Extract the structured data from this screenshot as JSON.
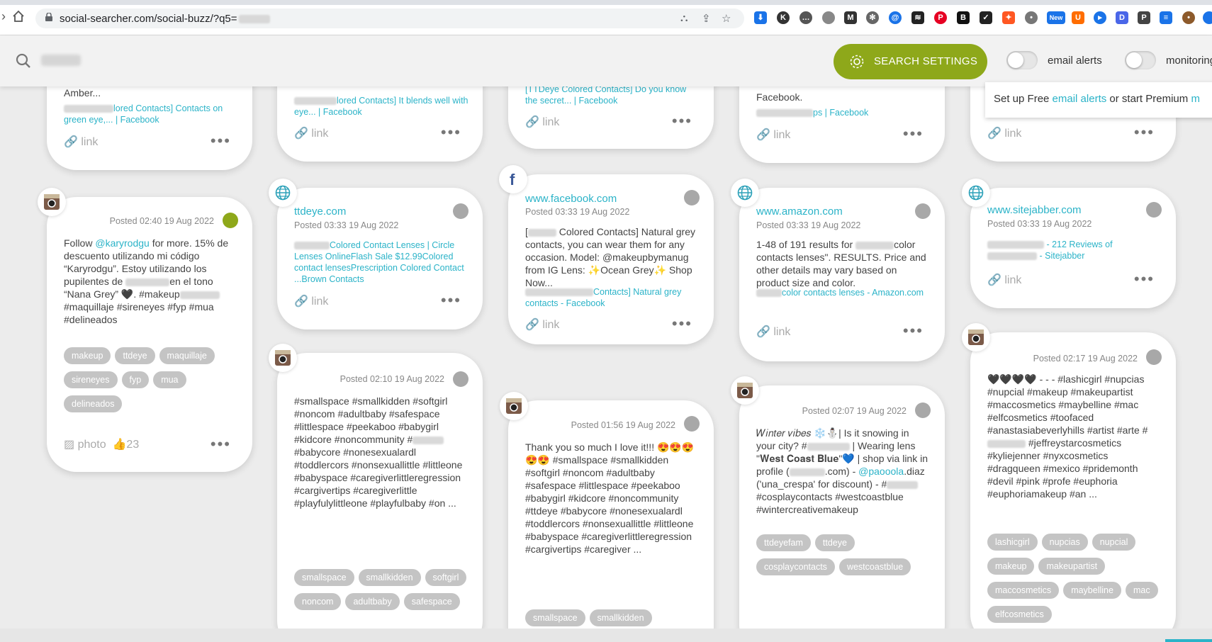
{
  "browser": {
    "url": "social-searcher.com/social-buzz/?q5="
  },
  "appbar": {
    "settings_label": "SEARCH SETTINGS",
    "email_alerts_label": "email alerts",
    "monitoring_label": "monitoring"
  },
  "tooltip": {
    "pre": "Set up Free ",
    "link1": "email alerts",
    "mid": " or start Premium ",
    "link2": "m"
  },
  "cards": {
    "c1": {
      "text": "Amber...",
      "link": "lored Contacts] Contacts on green eye,... | Facebook",
      "link_label": "link"
    },
    "c2": {
      "link": "lored Contacts] It blends well with eye... | Facebook",
      "link_label": "link"
    },
    "c3": {
      "link": "[TTDeye Colored Contacts] Do you know the secret... | Facebook",
      "link_label": "link"
    },
    "c4": {
      "text": "Facebook.",
      "link": "ps | Facebook",
      "link_label": "link"
    },
    "c5": {
      "link_label": "link"
    },
    "c6": {
      "date": "Posted 02:40 19 Aug 2022",
      "text1": "Follow ",
      "mention": "@karyrodgu",
      "text2": " for more. 15% de descuento utilizando mi código “Karyrodgu”. Estoy utilizando los pupilentes de ",
      "text3": "en el tono “Nana Grey” 🖤. #makeup",
      "text4": " #maquillaje #sireneyes #fyp #mua #delineados",
      "tags": [
        "makeup",
        "ttdeye",
        "maquillaje",
        "sireneyes",
        "fyp",
        "mua",
        "delineados"
      ],
      "photo_label": "photo",
      "likes": "23"
    },
    "c7": {
      "source": "ttdeye.com",
      "date": "Posted 03:33 19 Aug 2022",
      "link": "Colored Contact Lenses | Circle Lenses OnlineFlash Sale $12.99Colored contact lensesPrescription Colored Contact ...Brown Contacts",
      "link_label": "link"
    },
    "c8": {
      "source": "www.facebook.com",
      "date": "Posted 03:33 19 Aug 2022",
      "text": "Colored Contacts] Natural grey contacts, you can wear them for any occasion. Model: @makeupbymanug from IG Lens: ✨Ocean Grey✨ Shop Now...",
      "link": "Contacts] Natural grey contacts - Facebook",
      "link_label": "link"
    },
    "c9": {
      "source": "www.amazon.com",
      "date": "Posted 03:33 19 Aug 2022",
      "text1": "1-48 of 191 results for ",
      "text2": "color contacts lenses\". RESULTS. Price and other details may vary based on product size and color.",
      "link": "color contacts lenses - Amazon.com",
      "link_label": "link"
    },
    "c10": {
      "source": "www.sitejabber.com",
      "date": "Posted 03:33 19 Aug 2022",
      "link1": " - 212 Reviews of",
      "link2": " - Sitejabber",
      "link_label": "link"
    },
    "c11": {
      "date": "Posted 02:10 19 Aug 2022",
      "text": "#smallspace #smallkidden #softgirl #noncom #adultbaby #safespace #littlespace #peekaboo #babygirl #kidcore #noncommunity #",
      "text2": "#babycore #nonesexualardl #toddlercors #nonsexuallittle #littleone #babyspace #caregiverlittleregression #cargivertips #caregiverlittle #playfulylittleone #playfulbaby #on ...",
      "tags": [
        "smallspace",
        "smallkidden",
        "softgirl",
        "noncom",
        "adultbaby",
        "safespace"
      ]
    },
    "c12": {
      "date": "Posted 01:56 19 Aug 2022",
      "text": "Thank you so much I love it!!! 😍😍😍😍😍 #smallspace #smallkidden #softgirl #noncom #adultbaby #safespace #littlespace #peekaboo #babygirl #kidcore #noncommunity #ttdeye #babycore #nonesexualardl #toddlercors #nonsexuallittle #littleone #babyspace #caregiverlittleregression #cargivertips #caregiver ...",
      "tags": [
        "smallspace",
        "smallkidden"
      ]
    },
    "c13": {
      "date": "Posted 02:07 19 Aug 2022",
      "text1": "𝑊𝑖𝑛𝑡𝑒𝑟 𝑣𝑖𝑏𝑒𝑠 ❄️⛄| Is it snowing in your city? #",
      "text2": " | Wearing lens \"𝐖𝐞𝐬𝐭 𝐂𝐨𝐚𝐬𝐭 𝐁𝐥𝐮𝐞\"💙 | shop via link in profile (",
      "text3": ".com)  - ",
      "mention": "@paooola",
      "text4": ".diaz ('una_crespa' for discount) - #",
      "text5": " #cosplaycontacts #westcoastblue #wintercreativemakeup",
      "tags": [
        "ttdeyefam",
        "ttdeye",
        "cosplaycontacts",
        "westcoastblue"
      ]
    },
    "c14": {
      "date": "Posted 02:17 19 Aug 2022",
      "text": "🖤🖤🖤🖤 - - - #lashicgirl #nupcias #nupcial #makeup #makeupartist #maccosmetics #maybelline #mac #elfcosmetics #toofaced #anastasiabeverlyhills #artist #arte #",
      "text2": "#jeffreystarcosmetics #kyliejenner #nyxcosmetics #dragqueen #mexico #pridemonth #devil #pink #profe #euphoria #euphoriamakeup #an ...",
      "tags": [
        "lashicgirl",
        "nupcias",
        "nupcial",
        "makeup",
        "makeupartist",
        "maccosmetics",
        "maybelline",
        "mac",
        "elfcosmetics"
      ]
    }
  },
  "colors": {
    "accent": "#8ea81a",
    "link": "#2bb3c8",
    "tag": "#c4c4c4"
  }
}
